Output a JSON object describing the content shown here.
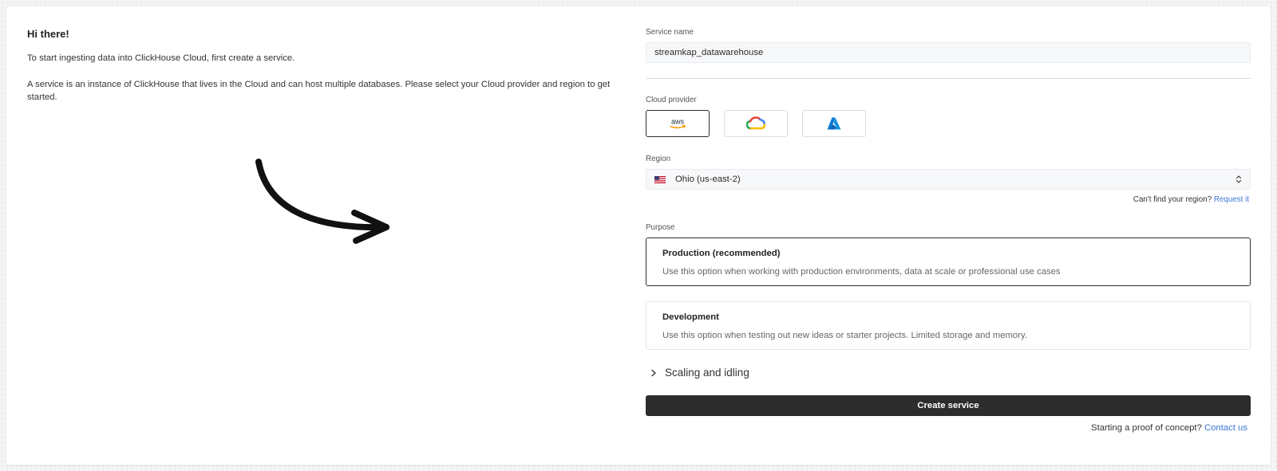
{
  "intro": {
    "greeting": "Hi there!",
    "line1": "To start ingesting data into ClickHouse Cloud, first create a service.",
    "line2": "A service is an instance of ClickHouse that lives in the Cloud and can host multiple databases. Please select your Cloud provider and region to get started."
  },
  "service_name": {
    "label": "Service name",
    "value": "streamkap_datawarehouse"
  },
  "cloud_provider": {
    "label": "Cloud provider",
    "options": [
      {
        "name": "aws-icon",
        "text": "aws",
        "selected": true
      },
      {
        "name": "google-cloud-icon",
        "selected": false
      },
      {
        "name": "azure-icon",
        "selected": false
      }
    ]
  },
  "region": {
    "label": "Region",
    "value": "Ohio (us-east-2)",
    "flag": "us-flag-icon",
    "help_text": "Can't find your region?",
    "help_link": "Request it"
  },
  "purpose": {
    "label": "Purpose",
    "options": [
      {
        "title": "Production (recommended)",
        "description": "Use this option when working with production environments, data at scale or professional use cases",
        "selected": true
      },
      {
        "title": "Development",
        "description": "Use this option when testing out new ideas or starter projects. Limited storage and memory.",
        "selected": false
      }
    ]
  },
  "scaling": {
    "label": "Scaling and idling"
  },
  "create_button": {
    "label": "Create service"
  },
  "proof_of_concept": {
    "text": "Starting a proof of concept?",
    "link": "Contact us"
  },
  "colors": {
    "link": "#3a77d8",
    "button_bg": "#2c2c2c",
    "azure": "#0a78d4"
  }
}
